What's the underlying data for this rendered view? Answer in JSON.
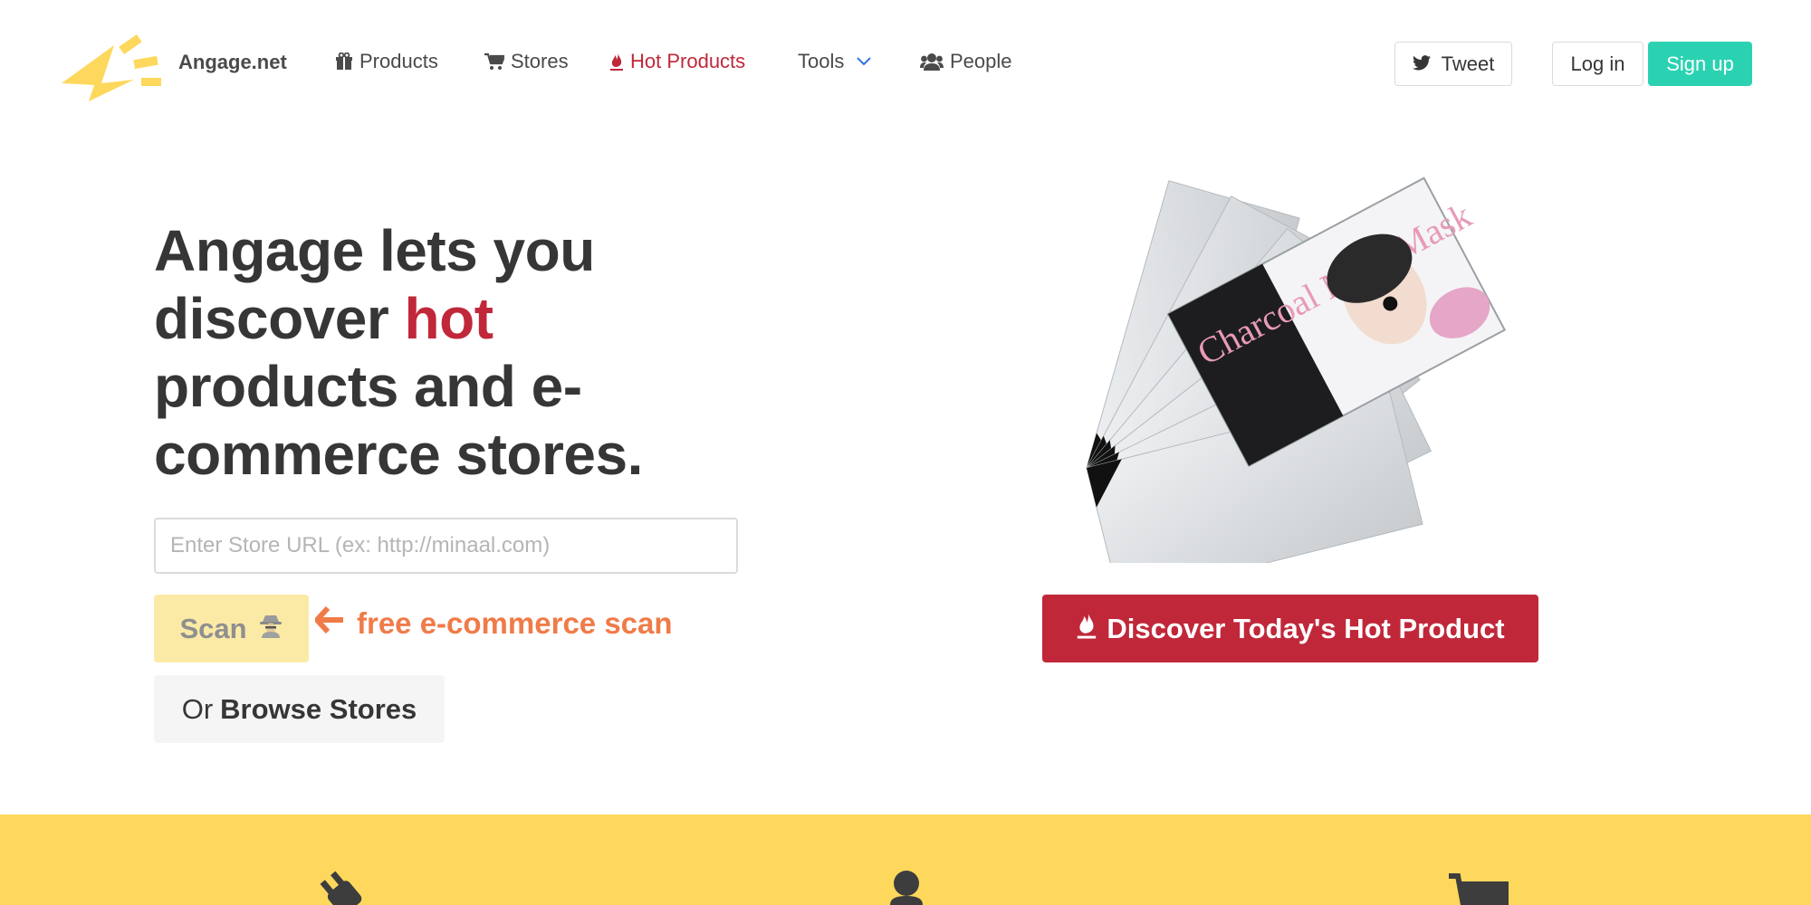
{
  "nav": {
    "brand": "Angage.net",
    "items": [
      {
        "label": "Products",
        "icon": "gift-icon"
      },
      {
        "label": "Stores",
        "icon": "cart-icon"
      },
      {
        "label": "Hot Products",
        "icon": "fire-icon"
      },
      {
        "label": "Tools",
        "icon": "chevron-down-icon"
      },
      {
        "label": "People",
        "icon": "users-icon"
      }
    ],
    "tweet": "Tweet",
    "login": "Log in",
    "signup": "Sign up"
  },
  "hero": {
    "title_before": "Angage lets you discover ",
    "title_hot": "hot",
    "title_after": " products and e-commerce stores.",
    "search_placeholder": "Enter Store URL (ex: http://minaal.com)",
    "scan_label": "Scan",
    "scan_hint": "free e-commerce scan",
    "browse_prefix": "Or",
    "browse_label": "Browse Stores"
  },
  "product": {
    "box_text": "Charcoal Nose Mask",
    "discover_label": "Discover Today's Hot Product"
  },
  "features": {
    "icons": [
      "plug-icon",
      "user-icon",
      "cart-icon"
    ]
  },
  "colors": {
    "accent_red": "#c0283a",
    "teal": "#2bd2b2",
    "band_yellow": "#fdd85d",
    "scan_yellow": "#fbeaa6",
    "hint_orange": "#f07b48"
  }
}
